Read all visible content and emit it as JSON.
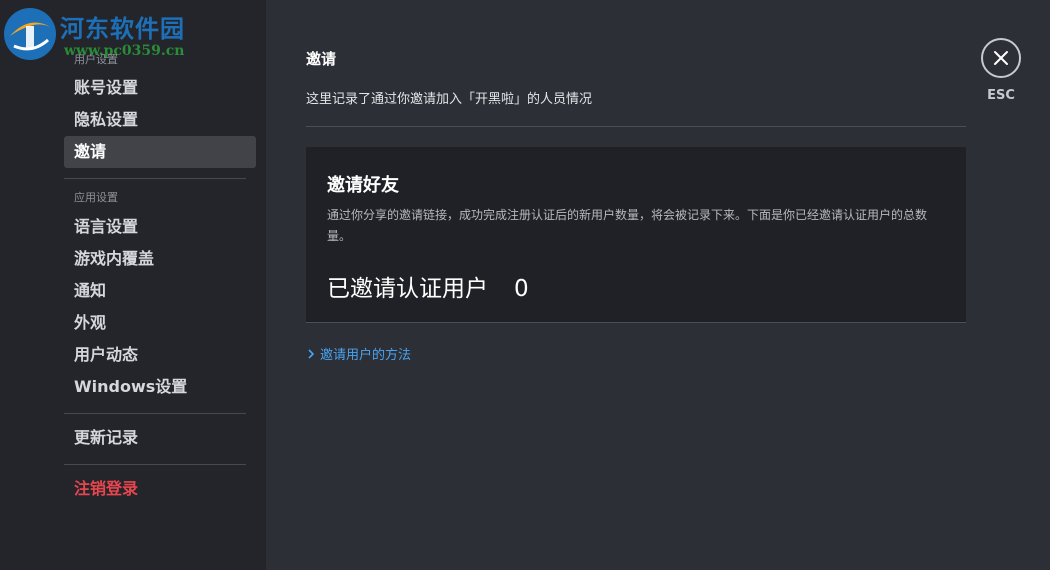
{
  "watermark": {
    "title": "河东软件园",
    "url": "www.pc0359.cn"
  },
  "sidebar": {
    "user_section_label": "用户设置",
    "user_items": [
      {
        "label": "账号设置"
      },
      {
        "label": "隐私设置"
      },
      {
        "label": "邀请",
        "active": true
      }
    ],
    "app_section_label": "应用设置",
    "app_items": [
      {
        "label": "语言设置"
      },
      {
        "label": "游戏内覆盖"
      },
      {
        "label": "通知"
      },
      {
        "label": "外观"
      },
      {
        "label": "用户动态"
      },
      {
        "label": "Windows设置"
      }
    ],
    "changelog_label": "更新记录",
    "logout_label": "注销登录"
  },
  "main": {
    "title": "邀请",
    "description": "这里记录了通过你邀请加入「开黑啦」的人员情况",
    "card": {
      "title": "邀请好友",
      "description": "通过你分享的邀请链接，成功完成注册认证后的新用户数量，将会被记录下来。下面是你已经邀请认证用户的总数量。",
      "stat_label": "已邀请认证用户",
      "stat_value": "0"
    },
    "howto_link": "邀请用户的方法"
  },
  "close": {
    "esc_label": "ESC"
  },
  "colors": {
    "background": "#2c2f36",
    "sidebar": "#23252b",
    "card": "#1f2126",
    "link": "#4aa3f0",
    "logout": "#e8464d"
  }
}
